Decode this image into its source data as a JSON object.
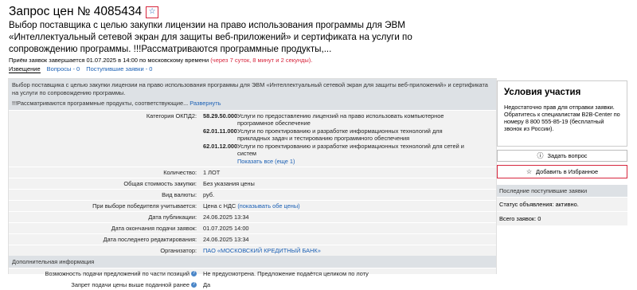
{
  "header": {
    "title": "Запрос цен № 4085434",
    "description": "Выбор поставщика с целью закупки лицензии на право использования программы для ЭВМ «Интеллектуальный сетевой экран для защиты веб-приложений» и сертификата на услуги по сопровождению программы. !!!Рассматриваются программные продукты,...",
    "deadline_text": "Приём заявок завершается 01.07.2025 в 14:00 по московскому времени",
    "deadline_remaining": "(через 7 суток, 8 минут и 2 секунды)."
  },
  "tabs": [
    {
      "label": "Извещение"
    },
    {
      "label": "Вопросы - 0"
    },
    {
      "label": "Поступившие заявки - 0"
    }
  ],
  "main": {
    "header_text": "Выбор поставщика с целью закупки лицензии на право использования программы для ЭВМ «Интеллектуальный сетевой экран для защиты веб-приложений» и сертификата на услуги по сопровождению программы.",
    "header_text2": "!!!Рассматриваются программные продукты, соответствующие...",
    "expand_link": "Развернуть",
    "okpd_label": "Категория ОКПД2:",
    "okpd": [
      {
        "code": "58.29.50.000",
        "text": "Услуги по предоставлению лицензий на право использовать компьютерное программное обеспечение"
      },
      {
        "code": "62.01.11.000",
        "text": "Услуги по проектированию и разработке информационных технологий для прикладных задач и тестированию программного обеспечения"
      },
      {
        "code": "62.01.12.000",
        "text": "Услуги по проектированию и разработке информационных технологий для сетей и систем"
      }
    ],
    "show_all": "Показать все (еще 1)",
    "rows": [
      {
        "label": "Количество:",
        "value": "1 ЛОТ"
      },
      {
        "label": "Общая стоимость закупки:",
        "value": "Без указания цены"
      },
      {
        "label": "Вид валюты:",
        "value": "руб."
      }
    ],
    "winner_label": "При выборе победителя учитывается:",
    "winner_value": "Цена с НДС",
    "winner_link": "(показывать обе цены)",
    "rows2": [
      {
        "label": "Дата публикации:",
        "value": "24.06.2025 13:34"
      },
      {
        "label": "Дата окончания подачи заявок:",
        "value": "01.07.2025 14:00"
      },
      {
        "label": "Дата последнего редактирования:",
        "value": "24.06.2025 13:34"
      }
    ],
    "organizer_label": "Организатор:",
    "organizer_value": "ПАО «МОСКОВСКИЙ КРЕДИТНЫЙ БАНК»",
    "additional_header": "Дополнительная информация",
    "additional": [
      {
        "label": "Возможность подачи предложений по части позиций",
        "value": "Не предусмотрена. Предложение подаётся целиком по лоту"
      },
      {
        "label": "Запрет подачи цены выше поданной ранее",
        "value": "Да"
      }
    ]
  },
  "side": {
    "cond_title": "Условия участия",
    "cond_text": "Недостаточно прав для отправки заявки. Обратитесь к специалистам B2B-Center по номеру 8 800 555-85-19 (бесплатный звонок из России).",
    "ask_button": "Задать вопрос",
    "fav_button": "Добавить в Избранное",
    "latest_header": "Последние поступившие заявки",
    "status": "Статус объявления: активно.",
    "total": "Всего заявок: 0"
  }
}
